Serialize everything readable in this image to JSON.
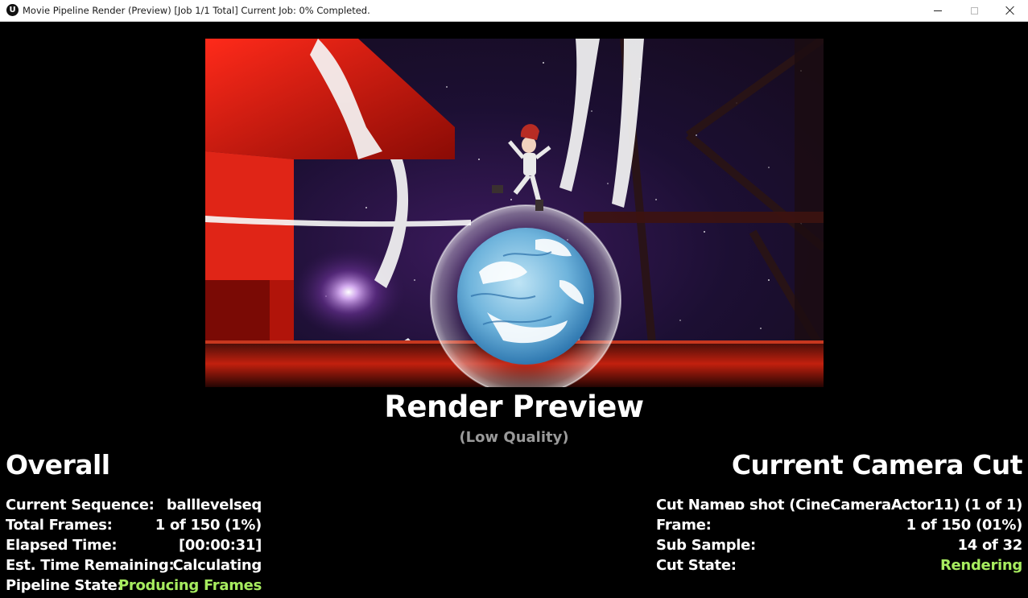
{
  "window": {
    "title": "Movie Pipeline Render (Preview) [Job 1/1 Total] Current Job: 0% Completed.",
    "app_icon": "unreal-engine-icon",
    "controls": [
      "minimize-icon",
      "maximize-icon",
      "close-icon"
    ]
  },
  "preview": {
    "title": "Render Preview",
    "subtitle": "(Low Quality)"
  },
  "overall": {
    "heading": "Overall",
    "rows": [
      {
        "label": "Current Sequence:",
        "value": "balllevelseq"
      },
      {
        "label": "Total Frames:",
        "value": "1 of 150 (1%)"
      },
      {
        "label": "Elapsed Time:",
        "value": "[00:00:31]"
      },
      {
        "label": "Est. Time Remaining:",
        "value": "Calculating"
      },
      {
        "label": "Pipeline State:",
        "value": "Producing Frames"
      }
    ]
  },
  "camera_cut": {
    "heading": "Current Camera Cut",
    "rows": [
      {
        "label": "Cut Name:",
        "value": "no shot (CineCameraActor11) (1 of 1)"
      },
      {
        "label": "Frame:",
        "value": "1 of 150 (01%)"
      },
      {
        "label": "Sub Sample:",
        "value": "14 of 32"
      },
      {
        "label": "Cut State:",
        "value": "Rendering"
      }
    ]
  },
  "colors": {
    "status_green": "#a7ec5f",
    "background": "#000000",
    "subtitle_gray": "#9a9a9a"
  }
}
